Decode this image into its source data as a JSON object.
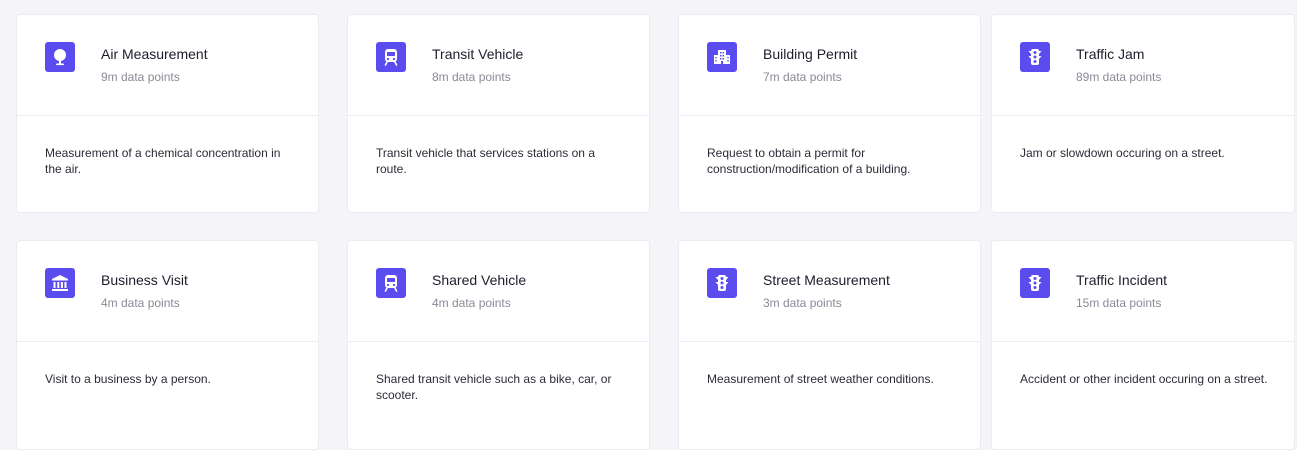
{
  "accent_color": "#5b4cf0",
  "cards": [
    {
      "title": "Air Measurement",
      "subtitle": "9m data points",
      "description": "Measurement of a chemical concentration in the air.",
      "icon": "map-pin-icon"
    },
    {
      "title": "Transit Vehicle",
      "subtitle": "8m data points",
      "description": "Transit vehicle that services stations on a route.",
      "icon": "train-icon"
    },
    {
      "title": "Building Permit",
      "subtitle": "7m data points",
      "description": "Request to obtain a permit for construction/modification of a building.",
      "icon": "building-icon"
    },
    {
      "title": "Traffic Jam",
      "subtitle": "89m data points",
      "description": "Jam or slowdown occuring on a street.",
      "icon": "traffic-light-icon"
    },
    {
      "title": "Business Visit",
      "subtitle": "4m data points",
      "description": "Visit to a business by a person.",
      "icon": "bank-icon"
    },
    {
      "title": "Shared Vehicle",
      "subtitle": "4m data points",
      "description": "Shared transit vehicle such as a bike, car, or scooter.",
      "icon": "train-icon"
    },
    {
      "title": "Street Measurement",
      "subtitle": "3m data points",
      "description": "Measurement of street weather conditions.",
      "icon": "traffic-light-icon"
    },
    {
      "title": "Traffic Incident",
      "subtitle": "15m data points",
      "description": "Accident or other incident occuring on a street.",
      "icon": "traffic-light-icon"
    }
  ]
}
